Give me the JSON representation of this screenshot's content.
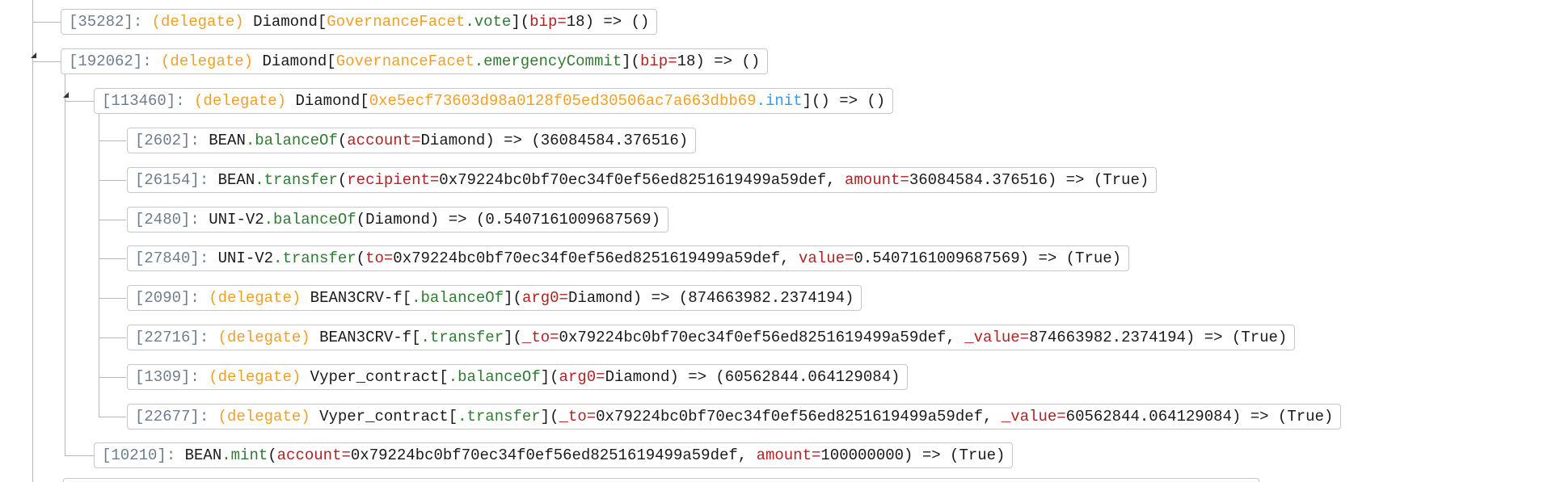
{
  "nodes": [
    {
      "gas": "[35282]:",
      "delegate": "(delegate)",
      "contract": "Diamond[",
      "facet": "GovernanceFacet",
      "dot_method": ".vote",
      "close": "](",
      "param": "bip",
      "eq": "=",
      "value": "18",
      "ret": ") => ()"
    },
    {
      "gas": "[192062]:",
      "delegate": "(delegate)",
      "contract": "Diamond[",
      "facet": "GovernanceFacet",
      "dot_method": ".emergencyCommit",
      "close": "](",
      "param": "bip",
      "eq": "=",
      "value": "18",
      "ret": ") => ()"
    },
    {
      "gas": "[113460]:",
      "delegate": "(delegate)",
      "contract": "Diamond[",
      "address": "0xe5ecf73603d98a0128f05ed30506ac7a663dbb69",
      "dot_method": ".init",
      "ret": "]() => ()"
    },
    {
      "gas": "[2602]:",
      "contract": "BEAN",
      "dot_method": ".balanceOf",
      "open": "(",
      "param": "account",
      "eq": "=",
      "value": "Diamond",
      "ret": ") => (36084584.376516)"
    },
    {
      "gas": "[26154]:",
      "contract": "BEAN",
      "dot_method": ".transfer",
      "open": "(",
      "param1": "recipient",
      "eq1": "=",
      "value1": "0x79224bc0bf70ec34f0ef56ed8251619499a59def, ",
      "param2": "amount",
      "eq2": "=",
      "value2": "36084584.376516",
      "ret": ") => (True)"
    },
    {
      "gas": "[2480]:",
      "contract": "UNI-V2",
      "dot_method": ".balanceOf",
      "open": "(",
      "value": "Diamond",
      "ret": ") => (0.5407161009687569)"
    },
    {
      "gas": "[27840]:",
      "contract": "UNI-V2",
      "dot_method": ".transfer",
      "open": "(",
      "param1": "to",
      "eq1": "=",
      "value1": "0x79224bc0bf70ec34f0ef56ed8251619499a59def, ",
      "param2": "value",
      "eq2": "=",
      "value2": "0.5407161009687569",
      "ret": ") => (True)"
    },
    {
      "gas": "[2090]:",
      "delegate": "(delegate)",
      "contract": "BEAN3CRV-f[",
      "dot_method": ".balanceOf",
      "close": "](",
      "param": "arg0",
      "eq": "=",
      "value": "Diamond",
      "ret": ") => (874663982.2374194)"
    },
    {
      "gas": "[22716]:",
      "delegate": "(delegate)",
      "contract": "BEAN3CRV-f[",
      "dot_method": ".transfer",
      "close": "](",
      "param1": "_to",
      "eq1": "=",
      "value1": "0x79224bc0bf70ec34f0ef56ed8251619499a59def, ",
      "param2": "_value",
      "eq2": "=",
      "value2": "874663982.2374194",
      "ret": ") => (True)"
    },
    {
      "gas": "[1309]:",
      "delegate": "(delegate)",
      "contract": "Vyper_contract[",
      "dot_method": ".balanceOf",
      "close": "](",
      "param": "arg0",
      "eq": "=",
      "value": "Diamond",
      "ret": ") => (60562844.064129084)"
    },
    {
      "gas": "[22677]:",
      "delegate": "(delegate)",
      "contract": "Vyper_contract[",
      "dot_method": ".transfer",
      "close": "](",
      "param1": "_to",
      "eq1": "=",
      "value1": "0x79224bc0bf70ec34f0ef56ed8251619499a59def, ",
      "param2": "_value",
      "eq2": "=",
      "value2": "60562844.064129084",
      "ret": ") => (True)"
    },
    {
      "gas": "[10210]:",
      "contract": "BEAN",
      "dot_method": ".mint",
      "open": "(",
      "param1": "account",
      "eq1": "=",
      "value1": "0x79224bc0bf70ec34f0ef56ed8251619499a59def, ",
      "param2": "amount",
      "eq2": "=",
      "value2": "100000000",
      "ret": ") => (True)"
    }
  ],
  "colors": {
    "gas": "#6f7d8c",
    "delegate": "#f0a028",
    "function": "#2e7d32",
    "address": "#f0a028",
    "init_method": "#3399ff",
    "parameter": "#b22222",
    "border": "#c7c7c7"
  },
  "icons": [
    "collapse-triangle-icon",
    "collapse-triangle-icon"
  ]
}
